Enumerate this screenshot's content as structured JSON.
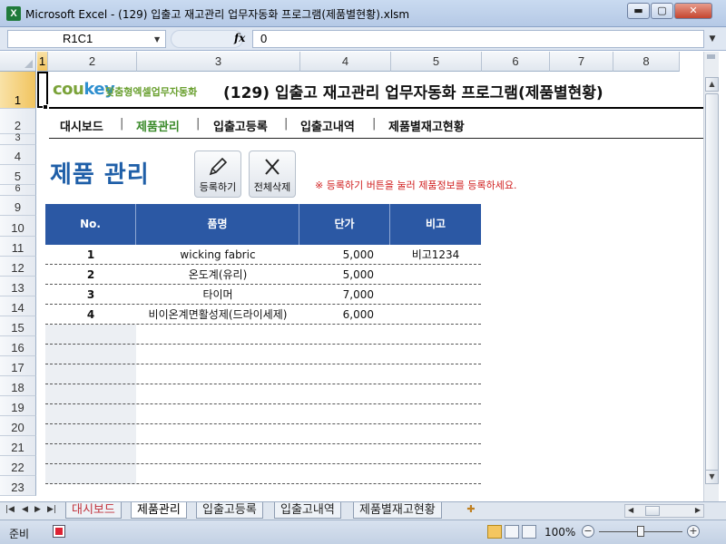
{
  "window": {
    "title": "Microsoft Excel - (129) 입출고 재고관리 업무자동화 프로그램(제품별현황).xlsm",
    "app_icon": "X",
    "minimize": "▬",
    "maximize": "▢",
    "close": "✕"
  },
  "formula_bar": {
    "name_box": "R1C1",
    "fx": "fx",
    "formula": "0"
  },
  "columns": [
    "1",
    "2",
    "3",
    "4",
    "5",
    "6",
    "7",
    "8"
  ],
  "rows": [
    "1",
    "2",
    "3",
    "4",
    "5",
    "6",
    "9",
    "10",
    "11",
    "12",
    "13",
    "14",
    "15",
    "16",
    "17",
    "18",
    "19",
    "20",
    "21",
    "22",
    "23"
  ],
  "banner": {
    "logo_part1": "cou",
    "logo_part2": "key",
    "slogan": "맞춤형엑셀업무자동화",
    "title": "(129) 입출고 재고관리 업무자동화 프로그램(제품별현황)"
  },
  "menu": [
    {
      "label": "대시보드"
    },
    {
      "label": "제품관리"
    },
    {
      "label": "입출고등록"
    },
    {
      "label": "입출고내역"
    },
    {
      "label": "제품별재고현황"
    }
  ],
  "page_title": "제품 관리",
  "buttons": {
    "register": "등록하기",
    "delete_all": "전체삭제"
  },
  "notice": "※ 등록하기 버튼을 눌러 제품정보를 등록하세요.",
  "table": {
    "headers": [
      "No.",
      "품명",
      "단가",
      "비고"
    ],
    "rows": [
      {
        "no": "1",
        "name": "wicking fabric",
        "price": "5,000",
        "memo": "비고1234"
      },
      {
        "no": "2",
        "name": "온도계(유리)",
        "price": "5,000",
        "memo": ""
      },
      {
        "no": "3",
        "name": "타이머",
        "price": "7,000",
        "memo": ""
      },
      {
        "no": "4",
        "name": "비이온계면활성제(드라이세제)",
        "price": "6,000",
        "memo": ""
      }
    ]
  },
  "sheet_tabs": [
    "대시보드",
    "제품관리",
    "입출고등록",
    "입출고내역",
    "제품별재고현황"
  ],
  "active_tab": "제품관리",
  "status": {
    "ready": "준비",
    "zoom": "100%"
  },
  "colors": {
    "header_blue": "#2b58a4",
    "page_title_blue": "#1f5fa8",
    "menu_active_green": "#3a8a2a",
    "notice_red": "#d02020"
  }
}
